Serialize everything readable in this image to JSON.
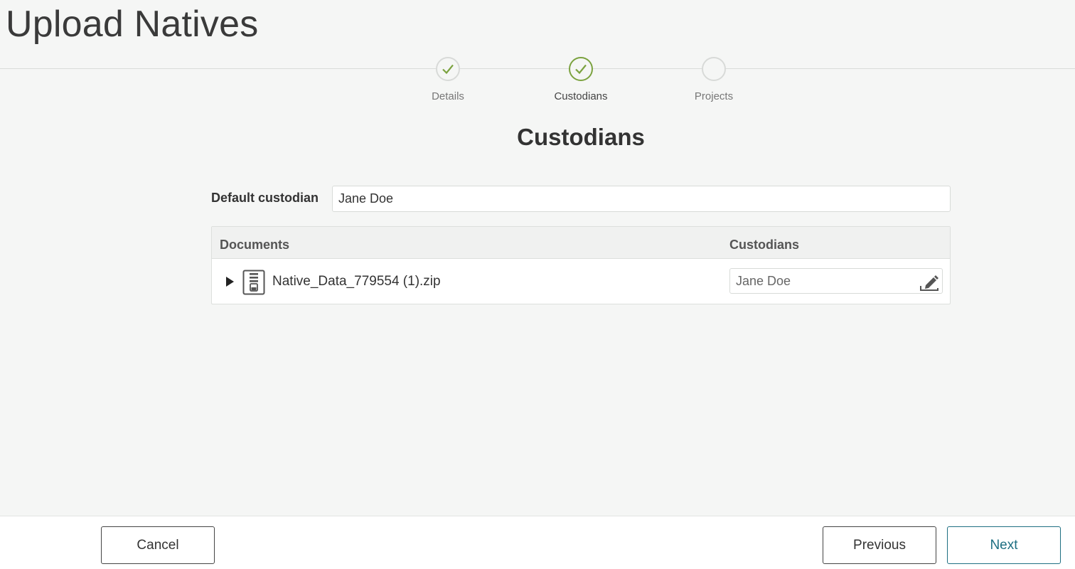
{
  "page": {
    "title": "Upload Natives"
  },
  "stepper": {
    "steps": [
      {
        "label": "Details",
        "state": "completed"
      },
      {
        "label": "Custodians",
        "state": "current"
      },
      {
        "label": "Projects",
        "state": "pending"
      }
    ],
    "accent_color": "#7ba23f"
  },
  "section": {
    "title": "Custodians"
  },
  "default_custodian": {
    "label": "Default custodian",
    "value": "Jane Doe"
  },
  "table": {
    "columns": {
      "documents": "Documents",
      "custodians": "Custodians"
    },
    "rows": [
      {
        "file_name": "Native_Data_779554 (1).zip",
        "icon": "zip-file-icon",
        "custodian": "Jane Doe"
      }
    ]
  },
  "footer": {
    "cancel_label": "Cancel",
    "previous_label": "Previous",
    "next_label": "Next",
    "next_color": "#1e6f82"
  }
}
